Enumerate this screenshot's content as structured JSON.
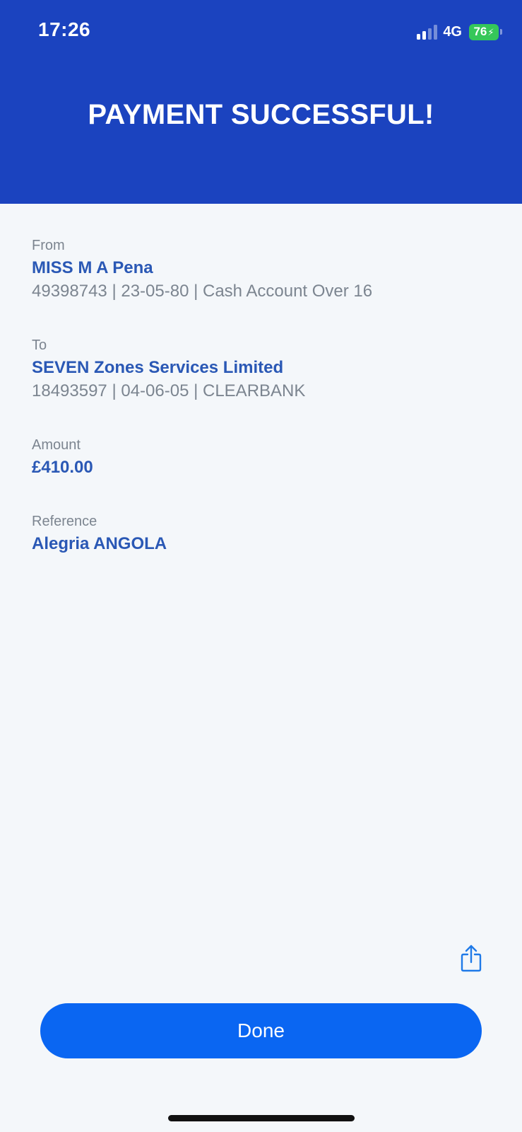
{
  "status_bar": {
    "time": "17:26",
    "network": "4G",
    "battery_level": "76",
    "battery_charging": true,
    "signal_bars_active": 2,
    "signal_bars_total": 4
  },
  "header": {
    "title": "PAYMENT SUCCESSFUL!",
    "background_color": "#1b43bf"
  },
  "details": {
    "from": {
      "label": "From",
      "name": "MISS M A Pena",
      "account": "49398743 | 23-05-80 | Cash Account Over 16"
    },
    "to": {
      "label": "To",
      "name": "SEVEN Zones Services Limited",
      "account": "18493597 | 04-06-05 | CLEARBANK"
    },
    "amount": {
      "label": "Amount",
      "value": "£410.00"
    },
    "reference": {
      "label": "Reference",
      "value": "Alegria ANGOLA"
    }
  },
  "actions": {
    "share_icon": "share-icon",
    "done_label": "Done"
  },
  "colors": {
    "accent": "#0a66f2",
    "value_text": "#2a58b5",
    "label_text": "#7c8590",
    "background": "#f4f7fa"
  }
}
